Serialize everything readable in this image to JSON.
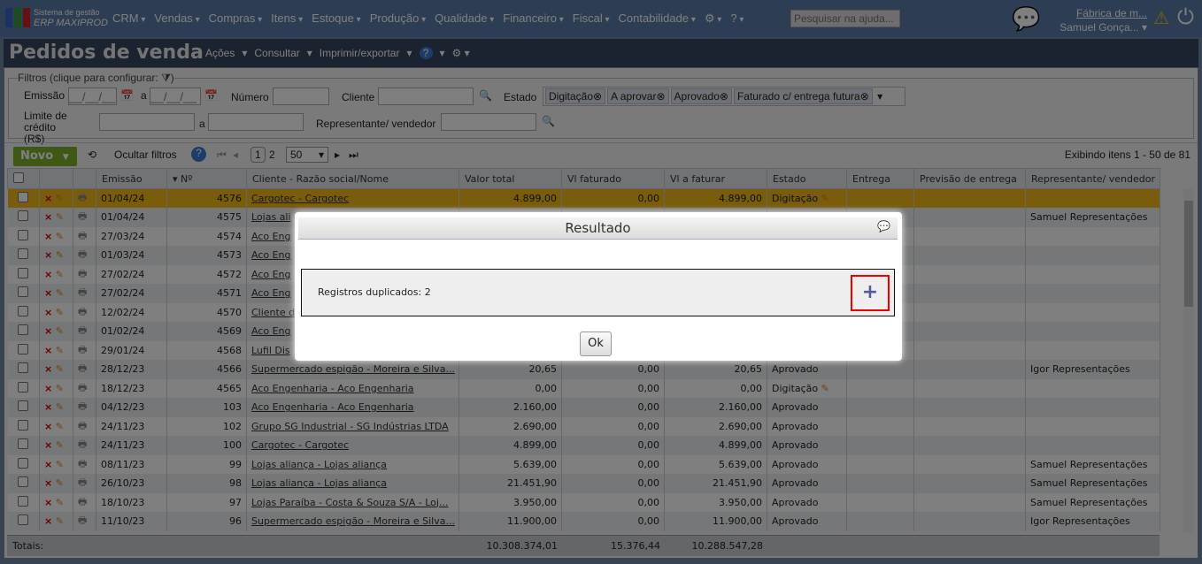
{
  "topbar": {
    "brand_small": "Sistema de gestão",
    "brand_name": "ERP MAXIPROD",
    "menu": [
      "CRM",
      "Vendas",
      "Compras",
      "Itens",
      "Estoque",
      "Produção",
      "Qualidade",
      "Financeiro",
      "Fiscal",
      "Contabilidade"
    ],
    "help_placeholder": "Pesquisar na ajuda...",
    "company": "Fábrica de m...",
    "user": "Samuel Gonça..."
  },
  "page": {
    "title": "Pedidos de venda",
    "menu": [
      "Ações",
      "Consultar",
      "Imprimir/exportar"
    ]
  },
  "filters": {
    "legend": "Filtros (clique para configurar:",
    "emissao": "Emissão",
    "date_placeholder": "__/__/__",
    "a": "a",
    "numero": "Número",
    "cliente": "Cliente",
    "estado": "Estado",
    "estado_chips": [
      "Digitação",
      "A aprovar",
      "Aprovado",
      "Faturado c/ entrega futura"
    ],
    "limite": "Limite de crédito (R$)",
    "representante": "Representante/ vendedor"
  },
  "toolbar": {
    "novo": "Novo",
    "ocultar": "Ocultar filtros",
    "pages": [
      "1",
      "2"
    ],
    "page_size": "50",
    "showing": "Exibindo itens 1 - 50 de 81"
  },
  "table": {
    "columns": [
      "Emissão",
      "Nº",
      "Cliente - Razão social/Nome",
      "Valor total",
      "Vl faturado",
      "Vl a faturar",
      "Estado",
      "Entrega",
      "Previsão de entrega",
      "Representante/ vendedor"
    ],
    "rows": [
      [
        "01/04/24",
        "4576",
        "Cargotec - Cargotec",
        "4.899,00",
        "0,00",
        "4.899,00",
        "Digitação",
        ""
      ],
      [
        "01/04/24",
        "4575",
        "Lojas ali",
        "",
        "",
        "",
        "",
        "Samuel Representações"
      ],
      [
        "27/03/24",
        "4574",
        "Aco Eng",
        "",
        "",
        "",
        "",
        ""
      ],
      [
        "01/03/24",
        "4573",
        "Aco Eng",
        "",
        "",
        "",
        "",
        ""
      ],
      [
        "27/02/24",
        "4572",
        "Aco Eng",
        "",
        "",
        "",
        "",
        ""
      ],
      [
        "27/02/24",
        "4571",
        "Aco Eng",
        "",
        "",
        "",
        "",
        ""
      ],
      [
        "12/02/24",
        "4570",
        "Cliente d",
        "",
        "",
        "",
        "",
        ""
      ],
      [
        "01/02/24",
        "4569",
        "Aco Eng",
        "",
        "",
        "",
        "",
        ""
      ],
      [
        "29/01/24",
        "4568",
        "Lufil Dis",
        "",
        "",
        "",
        "",
        ""
      ],
      [
        "28/12/23",
        "4566",
        "Supermercado espigão - Moreira e Silva...",
        "20,65",
        "0,00",
        "20,65",
        "Aprovado",
        "Igor Representações"
      ],
      [
        "18/12/23",
        "4565",
        "Aco Engenharia - Aco Engenharia",
        "0,00",
        "0,00",
        "0,00",
        "Digitação",
        ""
      ],
      [
        "04/12/23",
        "103",
        "Aco Engenharia - Aco Engenharia",
        "2.160,00",
        "0,00",
        "2.160,00",
        "Aprovado",
        ""
      ],
      [
        "24/11/23",
        "102",
        "Grupo SG Industrial - SG Indústrias LTDA",
        "2.690,00",
        "0,00",
        "2.690,00",
        "Aprovado",
        ""
      ],
      [
        "24/11/23",
        "100",
        "Cargotec - Cargotec",
        "4.899,00",
        "0,00",
        "4.899,00",
        "Aprovado",
        ""
      ],
      [
        "08/11/23",
        "99",
        "Lojas aliança - Lojas aliança",
        "5.639,00",
        "0,00",
        "5.639,00",
        "Aprovado",
        "Samuel Representações"
      ],
      [
        "26/10/23",
        "98",
        "Lojas aliança - Lojas aliança",
        "21.451,90",
        "0,00",
        "21.451,90",
        "Aprovado",
        "Samuel Representações"
      ],
      [
        "18/10/23",
        "97",
        "Lojas Paraíba - Costa & Souza S/A - Loj...",
        "3.950,00",
        "0,00",
        "3.950,00",
        "Aprovado",
        "Samuel Representações"
      ],
      [
        "11/10/23",
        "96",
        "Supermercado espigão - Moreira e Silva...",
        "11.900,00",
        "0,00",
        "11.900,00",
        "Aprovado",
        "Igor Representações"
      ]
    ],
    "totals": {
      "label": "Totais:",
      "valor_total": "10.308.374,01",
      "vl_faturado": "15.376,44",
      "vl_a_faturar": "10.288.547,28"
    }
  },
  "dialog": {
    "title": "Resultado",
    "message": "Registros duplicados: 2",
    "expand": "+",
    "ok": "Ok"
  },
  "colors": {
    "topbar": "#5b7ba6",
    "selected_row": "#f5b81a",
    "novo": "#7fb12a",
    "highlight_box": "#e00000"
  }
}
